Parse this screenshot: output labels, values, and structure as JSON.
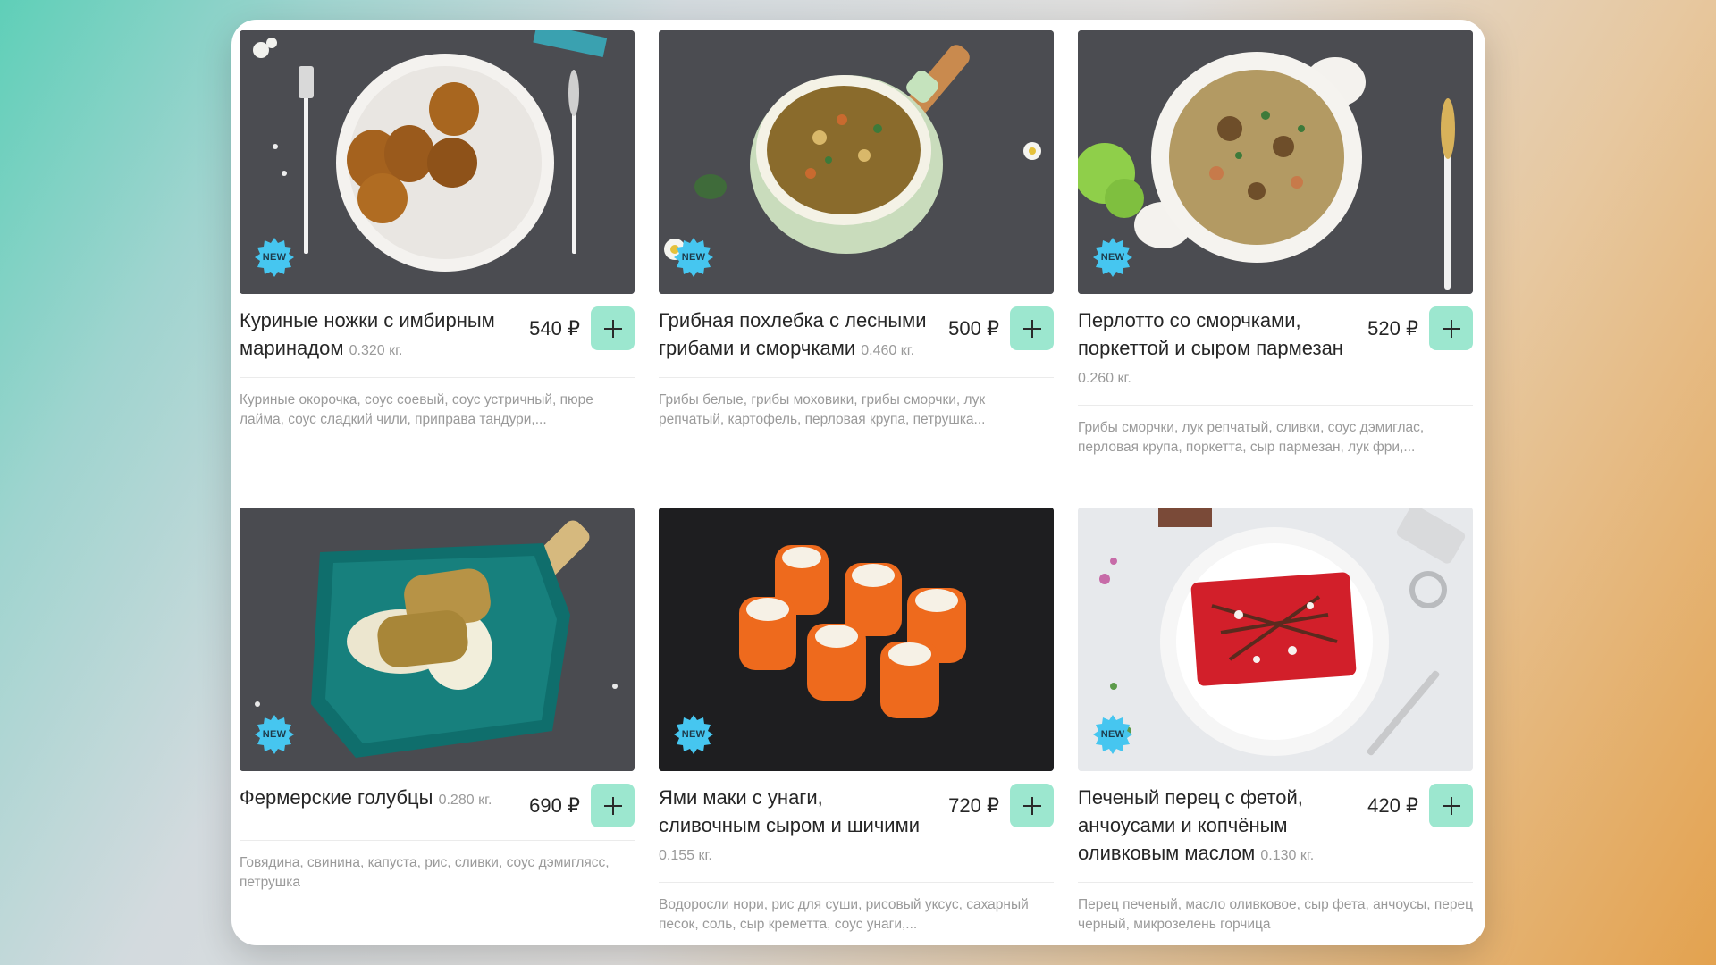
{
  "badge_label": "NEW",
  "accent_color": "#9ce7cf",
  "badge_color": "#46c6f0",
  "items": [
    {
      "title": "Куриные ножки с имбирным маринадом",
      "weight": "0.320 кг.",
      "price": "540 ₽",
      "description": "Куриные окорочка, соус соевый, соус устричный, пюре лайма, соус сладкий чили, приправа тандури,...",
      "image_icon": "grilled-chicken-plate"
    },
    {
      "title": "Грибная похлебка с лесными грибами и сморчками",
      "weight": "0.460 кг.",
      "price": "500 ₽",
      "description": "Грибы белые, грибы моховики, грибы сморчки, лук репчатый, картофель, перловая крупа, петрушка...",
      "image_icon": "mushroom-soup-pot"
    },
    {
      "title": "Перлотто со сморчками, поркеттой и сыром пармезан",
      "weight": "0.260 кг.",
      "price": "520 ₽",
      "description": "Грибы сморчки, лук репчатый, сливки, соус дэмиглас, перловая крупа, поркетта, сыр пармезан, лук фри,...",
      "image_icon": "barley-risotto-plate"
    },
    {
      "title": "Фермерские голубцы",
      "weight": "0.280 кг.",
      "price": "690 ₽",
      "description": "Говядина, свинина, капуста, рис, сливки, соус дэмиглясс, петрушка",
      "image_icon": "cabbage-rolls-pan"
    },
    {
      "title": "Ями маки с унаги, сливочным сыром и шичими",
      "weight": "0.155 кг.",
      "price": "720 ₽",
      "description": "Водоросли нори, рис для суши, рисовый уксус, сахарный песок, соль, сыр креметта, соус унаги,...",
      "image_icon": "sushi-rolls"
    },
    {
      "title": "Печеный перец с фетой, анчоусами и копчёным оливковым маслом",
      "weight": "0.130 кг.",
      "price": "420 ₽",
      "description": "Перец печеный, масло оливковое, сыр фета, анчоусы, перец черный, микрозелень горчица",
      "image_icon": "baked-pepper-plate"
    }
  ]
}
